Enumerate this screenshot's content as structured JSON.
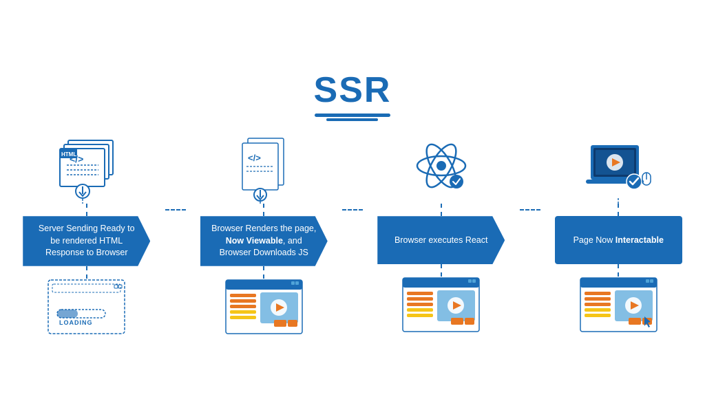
{
  "title": "SSR",
  "steps": [
    {
      "id": "step1",
      "label": "Server Sending Ready to be rendered HTML Response to Browser",
      "label_bold": "",
      "icon_type": "html-server",
      "screen_type": "loading"
    },
    {
      "id": "step2",
      "label": "Browser Renders the page, Now Viewable, and Browser Downloads JS",
      "label_bold": "Now Viewable",
      "icon_type": "js-file",
      "screen_type": "browser-viewable"
    },
    {
      "id": "step3",
      "label": "Browser executes React",
      "label_bold": "",
      "icon_type": "react-atom",
      "screen_type": "browser-react"
    },
    {
      "id": "step4",
      "label": "Page Now Interactable",
      "label_bold": "Interactable",
      "icon_type": "laptop",
      "screen_type": "browser-interactive"
    }
  ],
  "loading_text": "LOADING",
  "colors": {
    "blue": "#1a6bb5",
    "light_blue": "#4fa3d8",
    "orange": "#e87722",
    "yellow": "#f5c518",
    "red": "#d9534f"
  }
}
